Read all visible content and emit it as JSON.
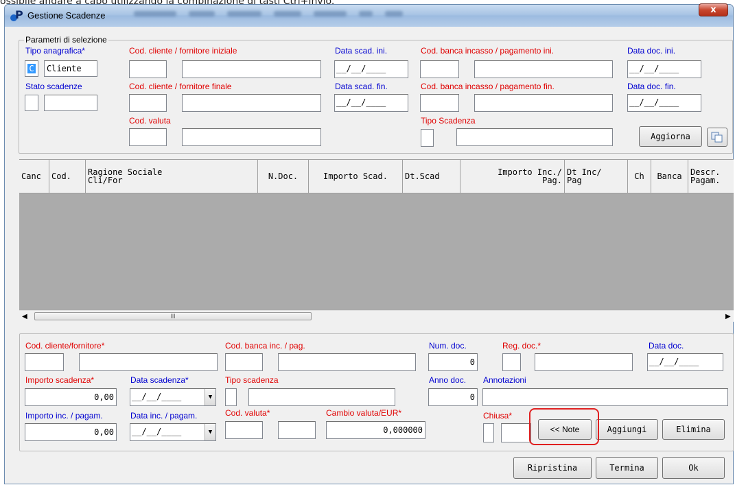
{
  "caption": "ossibile andare a capo utilizzando la combinazione di tasti Ctrl+Invio.",
  "window": {
    "title": "Gestione Scadenze",
    "close_symbol": "x",
    "app_icon": "p-app-icon"
  },
  "selection": {
    "legend": "Parametri di selezione",
    "tipo_anagrafica": {
      "label": "Tipo anagrafica*",
      "code": "C",
      "value": "Cliente"
    },
    "stato_scadenze": {
      "label": "Stato scadenze"
    },
    "cod_cliente_ini": {
      "label": "Cod. cliente / fornitore iniziale"
    },
    "cod_cliente_fin": {
      "label": "Cod. cliente / fornitore finale"
    },
    "cod_valuta": {
      "label": "Cod. valuta"
    },
    "data_scad_ini": {
      "label": "Data scad. ini.",
      "value": "__/__/____"
    },
    "data_scad_fin": {
      "label": "Data scad. fin.",
      "value": "__/__/____"
    },
    "cod_banca_ini": {
      "label": "Cod. banca incasso / pagamento ini."
    },
    "cod_banca_fin": {
      "label": "Cod. banca incasso / pagamento fin."
    },
    "tipo_scadenza": {
      "label": "Tipo Scadenza"
    },
    "data_doc_ini": {
      "label": "Data doc. ini.",
      "value": "__/__/____"
    },
    "data_doc_fin": {
      "label": "Data doc. fin.",
      "value": "__/__/____"
    },
    "aggiorna_button": "Aggiorna",
    "copy_icon": "copy-icon"
  },
  "grid": {
    "columns": [
      {
        "line1": "Canc",
        "line2": ""
      },
      {
        "line1": "Cod.",
        "line2": ""
      },
      {
        "line1": "Ragione Sociale",
        "line2": "Cli/For"
      },
      {
        "line1": "N.Doc.",
        "line2": ""
      },
      {
        "line1": "Importo Scad.",
        "line2": ""
      },
      {
        "line1": "Dt.Scad",
        "line2": ""
      },
      {
        "line1": "Importo Inc./",
        "line2": "Pag."
      },
      {
        "line1": "Dt Inc/",
        "line2": "Pag"
      },
      {
        "line1": "Ch",
        "line2": ""
      },
      {
        "line1": "Banca",
        "line2": ""
      },
      {
        "line1": "Descr.",
        "line2": "Pagam."
      }
    ],
    "scroll_thumb_grip": "III"
  },
  "detail": {
    "cod_cliente_fornitore": {
      "label": "Cod. cliente/fornitore*"
    },
    "cod_banca": {
      "label": "Cod. banca inc. / pag."
    },
    "num_doc": {
      "label": "Num. doc.",
      "value": "0"
    },
    "reg_doc": {
      "label": "Reg. doc.*"
    },
    "data_doc": {
      "label": "Data doc.",
      "value": "__/__/____"
    },
    "importo_scadenza": {
      "label": "Importo scadenza*",
      "value": "0,00"
    },
    "data_scadenza": {
      "label": "Data scadenza*",
      "value": "__/__/____"
    },
    "tipo_scadenza": {
      "label": "Tipo scadenza"
    },
    "anno_doc": {
      "label": "Anno doc.",
      "value": "0"
    },
    "annotazioni": {
      "label": "Annotazioni"
    },
    "importo_inc": {
      "label": "Importo inc. / pagam.",
      "value": "0,00"
    },
    "data_inc": {
      "label": "Data inc. / pagam.",
      "value": "__/__/____"
    },
    "cod_valuta": {
      "label": "Cod. valuta*"
    },
    "cambio_valuta": {
      "label": "Cambio valuta/EUR*",
      "value": "0,000000"
    },
    "chiusa": {
      "label": "Chiusa*"
    },
    "note_button": "<< Note",
    "aggiungi_button": "Aggiungi",
    "elimina_button": "Elimina"
  },
  "footer": {
    "ripristina_button": "Ripristina",
    "termina_button": "Termina",
    "ok_button": "Ok"
  },
  "colors": {
    "required_label": "#e00000",
    "optional_label": "#0000d0",
    "highlight": "#e02020"
  }
}
